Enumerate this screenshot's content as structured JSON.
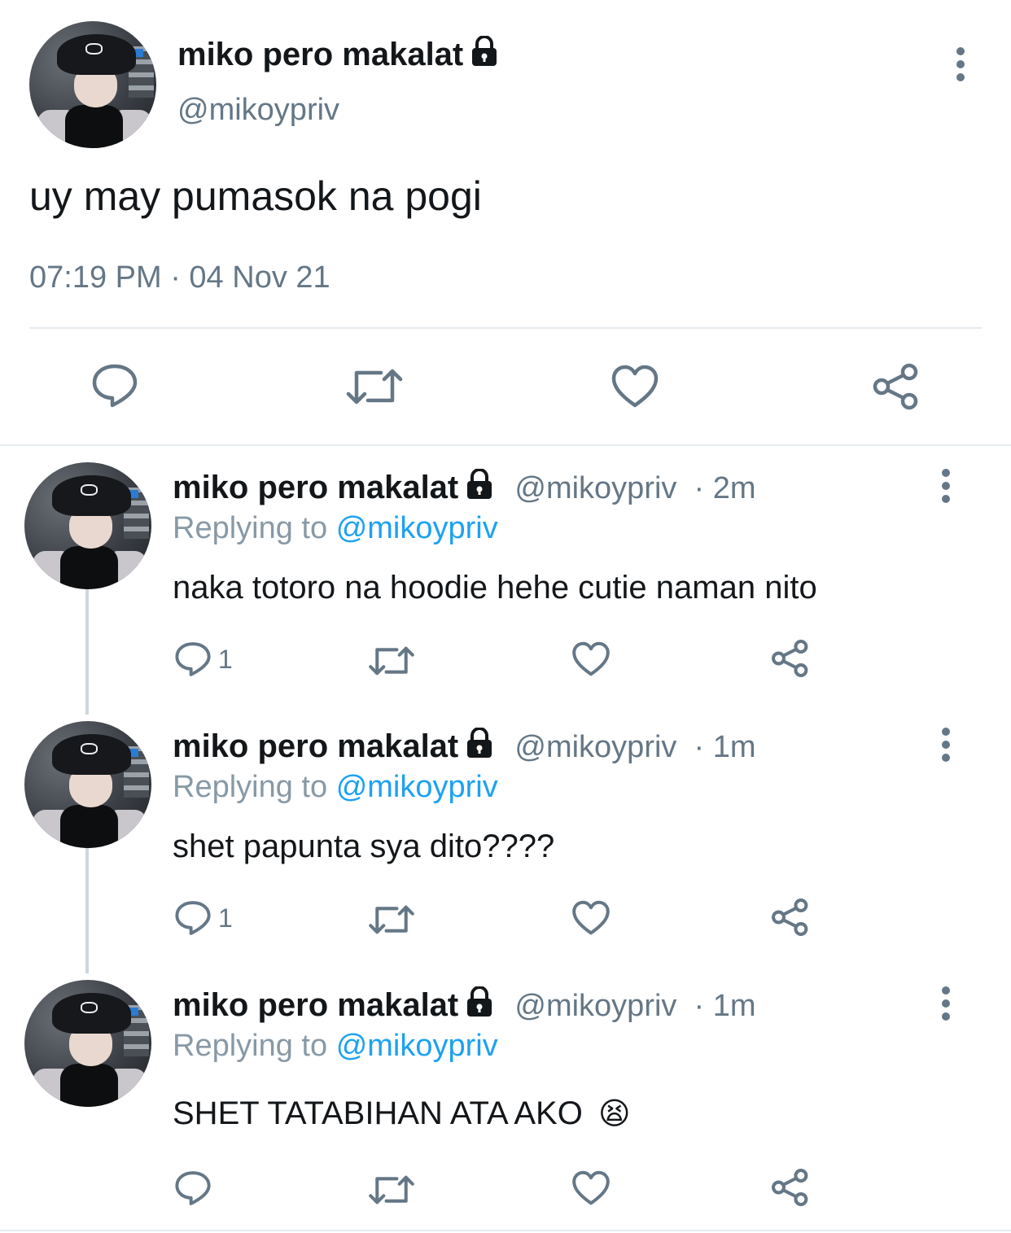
{
  "main_tweet": {
    "name": "miko pero makalat",
    "handle": "@mikoypriv",
    "text": "uy may pumasok na pogi",
    "timestamp": "07:19 PM · 04 Nov 21"
  },
  "replies": [
    {
      "name": "miko pero makalat",
      "handle": "@mikoypriv",
      "time": "· 2m",
      "replying_prefix": "Replying to",
      "replying_to": "@mikoypriv",
      "text": "naka totoro na hoodie hehe cutie naman nito",
      "reply_count": "1"
    },
    {
      "name": "miko pero makalat",
      "handle": "@mikoypriv",
      "time": "· 1m",
      "replying_prefix": "Replying to",
      "replying_to": "@mikoypriv",
      "text": "shet papunta sya dito????",
      "reply_count": "1"
    },
    {
      "name": "miko pero makalat",
      "handle": "@mikoypriv",
      "time": "· 1m",
      "replying_prefix": "Replying to",
      "replying_to": "@mikoypriv",
      "text": "SHET TATABIHAN ATA AKO",
      "emoji": "😫",
      "reply_count": ""
    }
  ],
  "icons": [
    "lock-icon",
    "more-icon",
    "reply-icon",
    "retweet-icon",
    "like-icon",
    "share-icon"
  ],
  "colors": {
    "text": "#14171a",
    "secondary": "#657786",
    "mention": "#1da1f2",
    "divider": "#e6ecf0"
  }
}
